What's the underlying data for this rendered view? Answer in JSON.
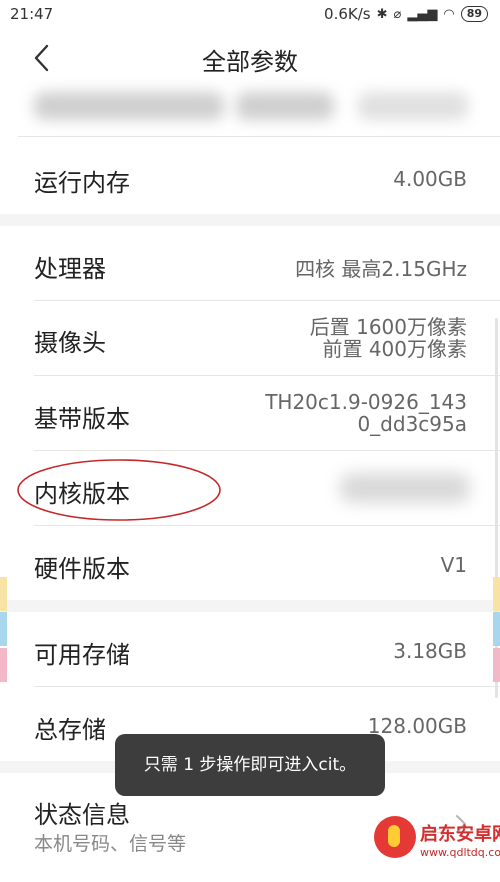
{
  "status_bar": {
    "time": "21:47",
    "speed": "0.6K/s",
    "battery": "89",
    "icons": [
      "bluetooth-icon",
      "alarm-off-icon",
      "signal-icon",
      "wifi-icon",
      "battery-icon"
    ]
  },
  "header": {
    "title": "全部参数",
    "back_icon": "chevron-left-icon"
  },
  "spec_rows": [
    {
      "label": "运行内存",
      "value": "4.00GB"
    },
    {
      "label": "处理器",
      "value": "四核 最高2.15GHz"
    },
    {
      "label": "摄像头",
      "value_lines": [
        "后置 1600万像素",
        "前置 400万像素"
      ]
    },
    {
      "label": "基带版本",
      "value_lines": [
        "TH20c1.9-0926_143",
        "0_dd3c95a"
      ]
    },
    {
      "label": "内核版本",
      "value": ""
    },
    {
      "label": "硬件版本",
      "value": "V1"
    },
    {
      "label": "可用存储",
      "value": "3.18GB"
    },
    {
      "label": "总存储",
      "value": "128.00GB"
    }
  ],
  "status_info": {
    "label": "状态信息",
    "subtitle": "本机号码、信号等",
    "chevron_icon": "chevron-right-icon"
  },
  "toast": {
    "message": "只需 1 步操作即可进入cit。"
  },
  "watermark": {
    "title": "启东安卓网",
    "url": "www.qdltdq.com"
  },
  "colors": {
    "highlight_ellipse": "#c62828",
    "toast_bg": "#3d3d3d",
    "watermark_red": "#d32f2f"
  }
}
